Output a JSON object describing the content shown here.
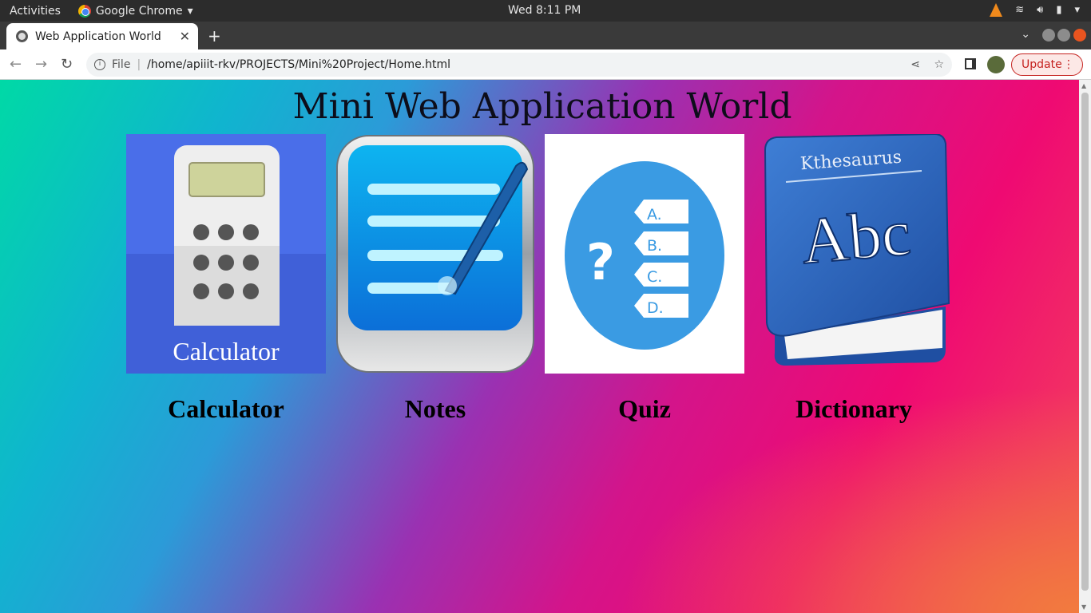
{
  "os": {
    "activities": "Activities",
    "app_name": "Google Chrome",
    "clock": "Wed  8:11 PM"
  },
  "browser": {
    "tab_title": "Web Application World",
    "scheme_label": "File",
    "url": "/home/apiiit-rkv/PROJECTS/Mini%20Project/Home.html",
    "update_label": "Update"
  },
  "page": {
    "title": "Mini Web Application World",
    "apps": [
      {
        "label": "Calculator",
        "icon": "calculator-icon",
        "icon_text": "Calculator"
      },
      {
        "label": "Notes",
        "icon": "notes-icon"
      },
      {
        "label": "Quiz",
        "icon": "quiz-icon",
        "options": [
          "A.",
          "B.",
          "C.",
          "D."
        ]
      },
      {
        "label": "Dictionary",
        "icon": "dictionary-icon",
        "book_title": "Kthesaurus",
        "book_text": "Abc"
      }
    ]
  },
  "colors": {
    "calc_bg": "#4a6ee9",
    "quiz_blue": "#3a9be3",
    "update_red": "#c5221f"
  }
}
